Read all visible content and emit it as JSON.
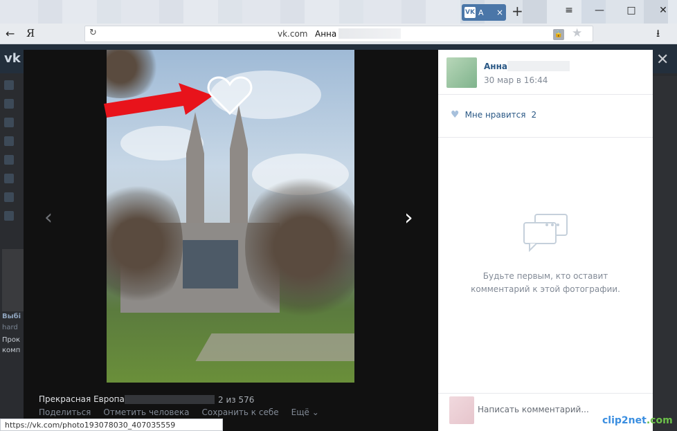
{
  "browser": {
    "tab": {
      "icon_label": "VK",
      "title": "А",
      "close": "×"
    },
    "new_tab": "+",
    "window_controls": {
      "menu": "≡",
      "minimize": "—",
      "maximize": "□",
      "close": "✕"
    },
    "back": "←",
    "yandex": "Я",
    "reload": "↻",
    "url_domain": "vk.com",
    "url_title": "Анна",
    "lock": "🔒",
    "bookmark": "★",
    "download": "⭳"
  },
  "vk": {
    "logo": "vk"
  },
  "viewer": {
    "prev": "‹",
    "next": "›",
    "album": "Прекрасная Европа",
    "counter": "2 из 576",
    "actions": [
      "Поделиться",
      "Отметить человека",
      "Сохранить к себе",
      "Ещё ⌄"
    ],
    "close": "✕"
  },
  "panel": {
    "author": "Анна",
    "date": "30 мар в 16:44",
    "like_label": "Мне нравится",
    "like_count": "2",
    "empty_line1": "Будьте первым, кто оставит",
    "empty_line2": "комментарий к этой фотографии.",
    "comment_placeholder": "Написать комментарий..."
  },
  "left_text": {
    "t1": "Выбі",
    "t2": "hard",
    "t3": "Прок",
    "t4": "комп"
  },
  "statusbar": {
    "url": "https://vk.com/photo193078030_407035559"
  },
  "watermark": {
    "a": "clip2net",
    "b": ".com"
  },
  "colors": {
    "vk_blue": "#4a76a8",
    "link": "#2a5885",
    "arrow": "#e8131b"
  }
}
